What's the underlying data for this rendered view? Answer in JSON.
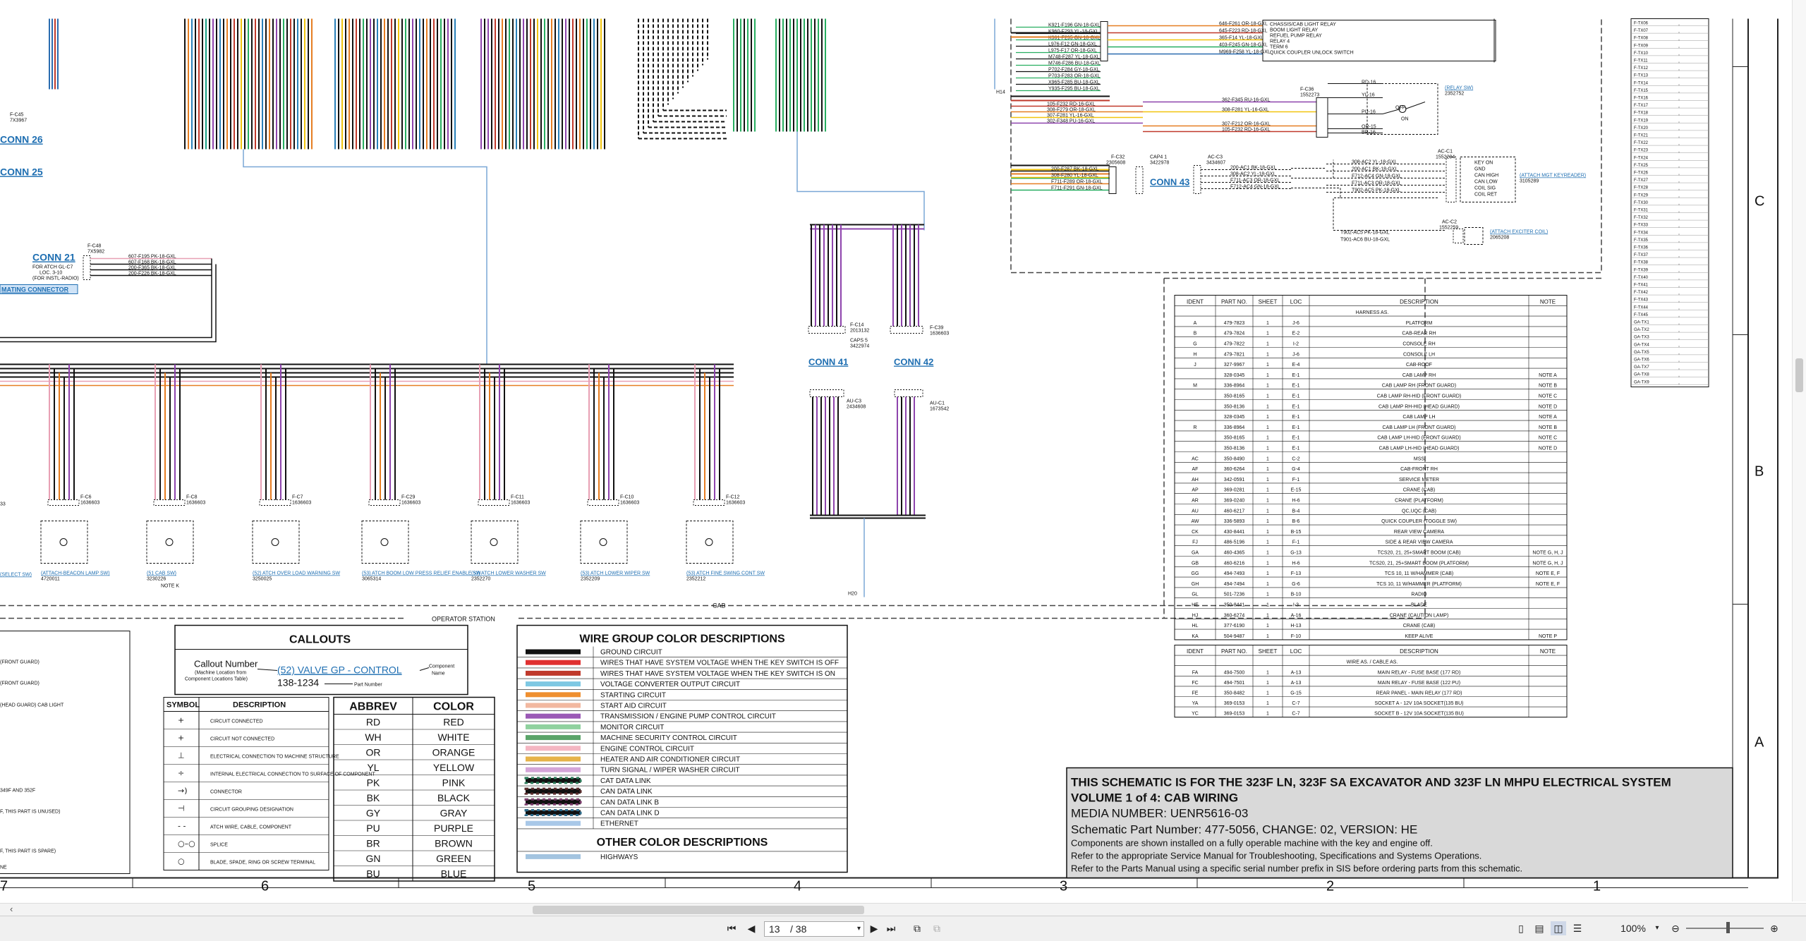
{
  "connectors_top": {
    "conn_26": "CONN 26",
    "conn_25": "CONN 25",
    "conn_21": "CONN 21",
    "conn_21_sub1": "FOR ATCH GL-C7",
    "conn_21_sub2": "LOC. 3-10",
    "conn_21_sub3": "(FOR INSTL-RADIO)",
    "mating_connector": "MATING CONNECTOR",
    "conn_41": "CONN 41",
    "conn_42": "CONN 42",
    "conn_43": "CONN 43",
    "f_c45": "F-C45",
    "f_c45_part": "7X3967",
    "f_c48": "F-C48",
    "f_c48_part": "7X5982",
    "f_c14": "F-C14",
    "f_c14_part": "2013132",
    "caps": "CAPS 5",
    "caps_part": "3422974",
    "f_c39": "F-C39",
    "f_c39_part": "1636603",
    "au_c3": "AU-C3",
    "au_c3_part": "2434608",
    "au_c1": "AU-C1",
    "au_c1_part": "1673542",
    "h20": "H20",
    "h14": "H14",
    "operator_station": "OPERATOR STATION",
    "cab": "CAB"
  },
  "conn21_wires": [
    "607-F195 PK-18-GXL",
    "607-F168 BK-18-GXL",
    "200-F365 BK-18-GXL",
    "200-F226 BK-18-GXL"
  ],
  "relay_wires": [
    "646-F261 OR-18-GXL",
    "645-F223 RD-18-GXL",
    "365-F14 YL-18-GXL",
    "403-F245 GN-18-GXL",
    "M969-F258 YL-18-GXL"
  ],
  "relay_labels": [
    "CHASSIS/CAB LIGHT RELAY",
    "BOOM LIGHT RELAY",
    "REFUEL PUMP RELAY",
    "RELAY 4",
    "TERM 6",
    "QUICK COUPLER UNLOCK SWITCH"
  ],
  "left_wires_mid": [
    "K921-F196 GN-18-GXL",
    "K960-F293 YL-18-GXL",
    "K961-F295 GN-18-GXL",
    "L976-F12 GN-18-GXL",
    "L975-F17 OR-18-GXL",
    "M748-F287 YL-18-GXL",
    "M746-F286 BU-18-GXL",
    "P702-F284 GY-18-GXL",
    "P703-F283 OR-18-GXL",
    "X965-F285 BU-18-GXL",
    "Y935-F295 BU-18-GXL"
  ],
  "mid_wires_2": [
    "105-F232 RD-16-GXL",
    "308-F279 OR-18-GXL",
    "307-F281 YL-16-GXL",
    "302-F348 PU-16-GXL"
  ],
  "c36_wires": [
    "362-F345 RU-16-GXL",
    "308-F281 YL-16-GXL",
    "307-F212 OR-16-GXL",
    "105-F232 RD-16-GXL"
  ],
  "c36": "F-C36",
  "c36_part": "1552273",
  "rd16": "RD-16",
  "yl16": "YL-16",
  "pu16": "PU-16",
  "or15": "OR-15",
  "br16": "BR-16",
  "relay_sw": "(RELAY SW)",
  "relay_sw_part": "2352752",
  "off": "OFF",
  "on": "ON",
  "c32_wires": [
    "200-F287 BK-18-GXL",
    "308-F280 YL-18-GXL",
    "F711-F289 OR-18-GXL",
    "F711-F291 GN-18-GXL"
  ],
  "c32": "F-C32",
  "c32_part": "2305608",
  "cap1": "CAP4 1",
  "cap1_part": "3422978",
  "ac_c3": "AC-C3",
  "ac_c3_part": "3434607",
  "ac_wires": [
    "200-AC1 BK-18-GXL",
    "308-AC2 YL-18-GXL",
    "F711-AC3 OR-18-GXL",
    "F712-AC4 GN-18-GXL"
  ],
  "ac_c1": "AC-C1",
  "ac_c1_part": "1552294",
  "ac_c1_wires": [
    "308-AC2 YL-18-GXL",
    "200-AC1 BK-18-GXL",
    "F712-AC4 GN-18-GXL",
    "F711-AC3 OR-18-GXL",
    "T902-AC5 PK-18-GXL"
  ],
  "ac_pins": [
    "KEY ON",
    "GND",
    "CAN HIGH",
    "CAN LOW",
    "COIL SIG",
    "COIL RET"
  ],
  "keyreader": "(ATTACH MGT KEYREADER)",
  "keyreader_part": "3105289",
  "ac_c2": "AC-C2",
  "ac_c2_part": "1552259",
  "ac_c2_wires": [
    "T902-AC5 PK-18-GXL",
    "T901-AC6 BU-18-GXL"
  ],
  "exciter": "(ATTACH EXCITER COIL)",
  "exciter_part": "2065208",
  "switches": [
    {
      "conn": "F-C6",
      "part": "1636603",
      "label": "(ATTACH-BEACON LAMP SW)",
      "pn": "4720011",
      "note": ""
    },
    {
      "conn": "F-C8",
      "part": "1636603",
      "label": "(51 CAB SW)",
      "pn": "3230226",
      "note": "NOTE K"
    },
    {
      "conn": "F-C7",
      "part": "1636603",
      "label": "(52) ATCH OVER LOAD WARNING SW",
      "pn": "3250025",
      "note": ""
    },
    {
      "conn": "F-C29",
      "part": "1636603",
      "label": "(53) ATCH BOOM LOW PRESS RELIEF ENABLE SW",
      "pn": "3065314",
      "note": ""
    },
    {
      "conn": "F-C11",
      "part": "1636603",
      "label": "(53) ATCH LOWER WASHER SW",
      "pn": "2352270",
      "note": ""
    },
    {
      "conn": "F-C10",
      "part": "1636603",
      "label": "(53) ATCH LOWER WIPER SW",
      "pn": "2352209",
      "note": ""
    },
    {
      "conn": "F-C12",
      "part": "1636603",
      "label": "(53) ATCH FINE SWING CONT SW",
      "pn": "2352212",
      "note": ""
    }
  ],
  "left_partial": [
    "(SELECT SW)",
    "(FRONT GUARD)",
    "(FRONT GUARD)",
    "(HEAD GUARD) CAB LIGHT",
    "349F AND 352F",
    "F, THIS PART IS UNUSED)",
    "F, THIS PART IS SPARE)",
    "NE",
    "33"
  ],
  "callouts": {
    "title": "CALLOUTS",
    "callout_number": "Callout Number",
    "machine_loc1": "(Machine Location from",
    "machine_loc2": "Component Locations Table)",
    "example": "(52) VALVE GP - CONTROL",
    "component": "Component",
    "name": "Name",
    "part_example": "138-1234",
    "part_number": "Part Number"
  },
  "symbols": {
    "header_symbol": "SYMBOL",
    "header_desc": "DESCRIPTION",
    "rows": [
      "CIRCUIT CONNECTED",
      "CIRCUIT NOT CONNECTED",
      "ELECTRICAL CONNECTION TO MACHINE STRUCTURE",
      "INTERNAL ELECTRICAL CONNECTION TO SURFACE OF COMPONENT",
      "CONNECTOR",
      "CIRCUIT GROUPING DESIGNATION",
      "ATCH WIRE, CABLE, COMPONENT",
      "SPLICE",
      "BLADE, SPADE, RING OR SCREW TERMINAL"
    ]
  },
  "abbrev": {
    "h1": "ABBREV",
    "h2": "COLOR",
    "rows": [
      [
        "RD",
        "RED"
      ],
      [
        "WH",
        "WHITE"
      ],
      [
        "OR",
        "ORANGE"
      ],
      [
        "YL",
        "YELLOW"
      ],
      [
        "PK",
        "PINK"
      ],
      [
        "BK",
        "BLACK"
      ],
      [
        "GY",
        "GRAY"
      ],
      [
        "PU",
        "PURPLE"
      ],
      [
        "BR",
        "BROWN"
      ],
      [
        "GN",
        "GREEN"
      ],
      [
        "BU",
        "BLUE"
      ]
    ]
  },
  "wire_groups": {
    "title": "WIRE GROUP COLOR DESCRIPTIONS",
    "rows": [
      {
        "color": "#111111",
        "label": "GROUND CIRCUIT"
      },
      {
        "color": "#e03030",
        "label": "WIRES THAT HAVE SYSTEM VOLTAGE WHEN THE KEY SWITCH IS OFF"
      },
      {
        "color": "#c0392b",
        "label": "WIRES THAT HAVE SYSTEM VOLTAGE WHEN THE KEY SWITCH IS ON"
      },
      {
        "color": "#7ec8e3",
        "label": "VOLTAGE CONVERTER OUTPUT CIRCUIT"
      },
      {
        "color": "#ef8f2f",
        "label": "STARTING CIRCUIT"
      },
      {
        "color": "#f2b8a0",
        "label": "START AID CIRCUIT"
      },
      {
        "color": "#9b59b6",
        "label": "TRANSMISSION / ENGINE PUMP CONTROL CIRCUIT"
      },
      {
        "color": "#8fd19e",
        "label": "MONITOR CIRCUIT"
      },
      {
        "color": "#5aa469",
        "label": "MACHINE SECURITY CONTROL CIRCUIT"
      },
      {
        "color": "#f4b6c2",
        "label": "ENGINE CONTROL CIRCUIT"
      },
      {
        "color": "#e6b34a",
        "label": "HEATER AND AIR CONDITIONER CIRCUIT"
      },
      {
        "color": "#d4a5d8",
        "label": "TURN SIGNAL / WIPER WASHER CIRCUIT"
      },
      {
        "color": "#2e7d5b",
        "label": "CAT DATA LINK"
      },
      {
        "color": "#5a2d2d",
        "label": "CAN DATA LINK"
      },
      {
        "color": "#7a3b6b",
        "label": "CAN DATA LINK B"
      },
      {
        "color": "#2e6b8a",
        "label": "CAN DATA LINK D"
      },
      {
        "color": "#a8c8e8",
        "label": "ETHERNET"
      }
    ],
    "other_title": "OTHER COLOR DESCRIPTIONS",
    "other_rows": [
      {
        "color": "#a3c4e0",
        "label": "HIGHWAYS"
      }
    ]
  },
  "harness_table": {
    "headers": [
      "IDENT",
      "PART NO.",
      "SHEET",
      "LOC",
      "DESCRIPTION",
      "NOTE"
    ],
    "subtitle": "HARNESS AS.",
    "rows": [
      [
        "A",
        "479-7823",
        "1",
        "J-6",
        "PLATFORM",
        ""
      ],
      [
        "B",
        "479-7824",
        "1",
        "E-2",
        "CAB-REAR RH",
        ""
      ],
      [
        "G",
        "479-7822",
        "1",
        "I-2",
        "CONSOLE RH",
        ""
      ],
      [
        "H",
        "479-7821",
        "1",
        "J-6",
        "CONSOLE LH",
        ""
      ],
      [
        "J",
        "327-9967",
        "1",
        "E-4",
        "CAB-ROOF",
        ""
      ],
      [
        "",
        "328-0345",
        "1",
        "E-1",
        "CAB LAMP RH",
        "NOTE A"
      ],
      [
        "M",
        "336-8964",
        "1",
        "E-1",
        "CAB LAMP RH (FRONT GUARD)",
        "NOTE B"
      ],
      [
        "",
        "350-8165",
        "1",
        "E-1",
        "CAB LAMP RH-HID (FRONT GUARD)",
        "NOTE C"
      ],
      [
        "",
        "350-8136",
        "1",
        "E-1",
        "CAB LAMP RH-HID (HEAD GUARD)",
        "NOTE D"
      ],
      [
        "",
        "328-0345",
        "1",
        "E-1",
        "CAB LAMP LH",
        "NOTE A"
      ],
      [
        "R",
        "336-8964",
        "1",
        "E-1",
        "CAB LAMP LH (FRONT GUARD)",
        "NOTE B"
      ],
      [
        "",
        "350-8165",
        "1",
        "E-1",
        "CAB LAMP LH-HID (FRONT GUARD)",
        "NOTE C"
      ],
      [
        "",
        "350-8136",
        "1",
        "E-1",
        "CAB LAMP LH-HID (HEAD GUARD)",
        "NOTE D"
      ],
      [
        "AC",
        "350-8490",
        "1",
        "C-2",
        "MSS",
        ""
      ],
      [
        "AF",
        "360-6264",
        "1",
        "G-4",
        "CAB-FRONT RH",
        ""
      ],
      [
        "AH",
        "342-0591",
        "1",
        "F-1",
        "SERVICE METER",
        ""
      ],
      [
        "AP",
        "369-0281",
        "1",
        "E-15",
        "CRANE (CAB)",
        ""
      ],
      [
        "AR",
        "369-0240",
        "1",
        "H-6",
        "CRANE (PLATFORM)",
        ""
      ],
      [
        "AU",
        "460-6217",
        "1",
        "B-4",
        "QC,UQC (CAB)",
        ""
      ],
      [
        "AW",
        "336-5893",
        "1",
        "B-6",
        "QUICK COUPLER (TOGGLE SW)",
        ""
      ],
      [
        "CK",
        "430-8441",
        "1",
        "B-15",
        "REAR VIEW CAMERA",
        ""
      ],
      [
        "FJ",
        "486-5196",
        "1",
        "F-1",
        "SIDE & REAR VIEW CAMERA",
        ""
      ],
      [
        "GA",
        "460-4365",
        "1",
        "G-13",
        "TCS20, 21, 25+SMART BOOM (CAB)",
        "NOTE G, H, J"
      ],
      [
        "GB",
        "460-6216",
        "1",
        "H-6",
        "TCS20, 21, 25+SMART BOOM (PLATFORM)",
        "NOTE G, H, J"
      ],
      [
        "GG",
        "494-7493",
        "1",
        "F-13",
        "TCS 10, 11 W/HAMMER (CAB)",
        "NOTE E, F"
      ],
      [
        "GH",
        "494-7494",
        "1",
        "G-6",
        "TCS 10, 11 W/HAMMER (PLATFORM)",
        "NOTE E, F"
      ],
      [
        "GL",
        "501-7236",
        "1",
        "B-10",
        "RADIO",
        ""
      ],
      [
        "HE",
        "350-8441",
        "1",
        "I-3",
        "BLADE",
        ""
      ],
      [
        "HJ",
        "360-6274",
        "1",
        "A-16",
        "CRANE (CAUTION LAMP)",
        ""
      ],
      [
        "HL",
        "377-6190",
        "1",
        "H-13",
        "CRANE (CAB)",
        ""
      ],
      [
        "KA",
        "504-9487",
        "1",
        "F-10",
        "KEEP ALIVE",
        "NOTE P"
      ]
    ]
  },
  "wire_table": {
    "headers": [
      "IDENT",
      "PART NO.",
      "SHEET",
      "LOC",
      "DESCRIPTION",
      "NOTE"
    ],
    "subtitle": "WIRE AS. / CABLE AS.",
    "rows": [
      [
        "FA",
        "494-7500",
        "1",
        "A-13",
        "MAIN RELAY - FUSE BASE (177 RD)",
        ""
      ],
      [
        "FC",
        "494-7501",
        "1",
        "A-13",
        "MAIN RELAY - FUSE BASE (122 PU)",
        ""
      ],
      [
        "FE",
        "350-8482",
        "1",
        "G-15",
        "REAR PANEL - MAIN RELAY (177 RD)",
        ""
      ],
      [
        "YA",
        "369-0153",
        "1",
        "C-7",
        "SOCKET A - 12V 10A SOCKET(135 BU)",
        ""
      ],
      [
        "YC",
        "369-0153",
        "1",
        "C-7",
        "SOCKET B - 12V 10A SOCKET(135 BU)",
        ""
      ]
    ]
  },
  "title_block": {
    "line1": "THIS SCHEMATIC IS FOR THE 323F LN, 323F SA EXCAVATOR AND 323F LN MHPU ELECTRICAL SYSTEM",
    "line2": "VOLUME 1 of 4: CAB WIRING",
    "line3": "MEDIA NUMBER: UENR5616-03",
    "line4": "Schematic Part Number: 477-5056, CHANGE: 02, VERSION: HE",
    "line5": "Components are shown installed on a fully operable machine with the key and engine off.",
    "line6": "Refer to the appropriate Service Manual for Troubleshooting, Specifications and Systems Operations.",
    "line7": "Refer to the Parts Manual using a specific serial number prefix in SIS before ordering parts from this schematic."
  },
  "zones": {
    "bottom": [
      "7",
      "6",
      "5",
      "4",
      "3",
      "2",
      "1"
    ],
    "right": [
      "C",
      "B",
      "A"
    ]
  },
  "right_list": [
    "F-TX06",
    "F-TX07",
    "F-TX08",
    "F-TX09",
    "F-TX10",
    "F-TX11",
    "F-TX12",
    "F-TX13",
    "F-TX14",
    "F-TX15",
    "F-TX16",
    "F-TX17",
    "F-TX18",
    "F-TX19",
    "F-TX20",
    "F-TX21",
    "F-TX22",
    "F-TX23",
    "F-TX24",
    "F-TX25",
    "F-TX26",
    "F-TX27",
    "F-TX28",
    "F-TX29",
    "F-TX30",
    "F-TX31",
    "F-TX32",
    "F-TX33",
    "F-TX34",
    "F-TX35",
    "F-TX36",
    "F-TX37",
    "F-TX38",
    "F-TX39",
    "F-TX40",
    "F-TX41",
    "F-TX42",
    "F-TX43",
    "F-TX44",
    "F-TX45",
    "GA-TX1",
    "GA-TX2",
    "GA-TX3",
    "GA-TX4",
    "GA-TX5",
    "GA-TX6",
    "GA-TX7",
    "GA-TX8",
    "GA-TX9"
  ],
  "viewer": {
    "page_current": "13",
    "page_total": "/ 38",
    "zoom": "100%"
  }
}
